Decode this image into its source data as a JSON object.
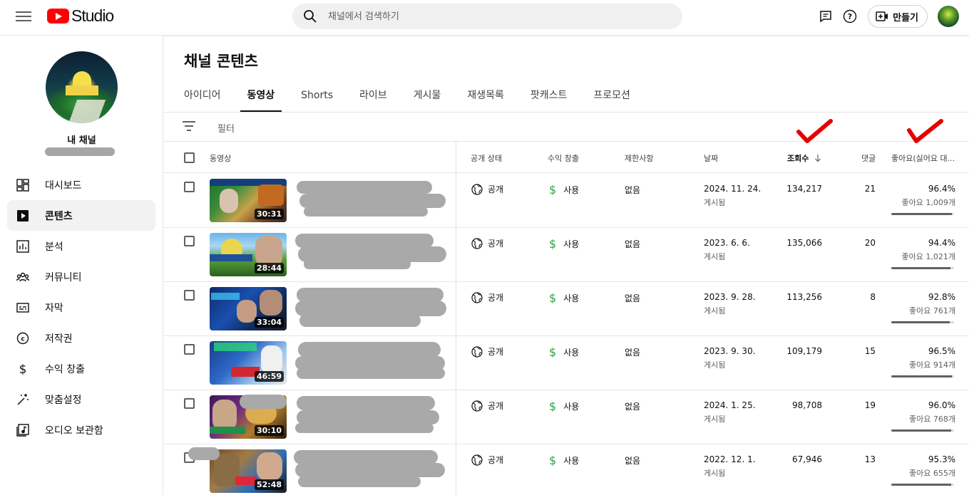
{
  "app": {
    "name": "Studio"
  },
  "search": {
    "placeholder": "채널에서 검색하기"
  },
  "header": {
    "create_label": "만들기"
  },
  "sidebar": {
    "channel_label": "내 채널",
    "items": [
      {
        "label": "대시보드",
        "icon": "dashboard-icon",
        "active": false
      },
      {
        "label": "콘텐츠",
        "icon": "content-icon",
        "active": true
      },
      {
        "label": "분석",
        "icon": "analytics-icon",
        "active": false
      },
      {
        "label": "커뮤니티",
        "icon": "community-icon",
        "active": false
      },
      {
        "label": "자막",
        "icon": "subtitles-icon",
        "active": false
      },
      {
        "label": "저작권",
        "icon": "copyright-icon",
        "active": false
      },
      {
        "label": "수익 창출",
        "icon": "dollar-icon",
        "active": false
      },
      {
        "label": "맞춤설정",
        "icon": "magic-wand-icon",
        "active": false
      },
      {
        "label": "오디오 보관함",
        "icon": "audio-library-icon",
        "active": false
      }
    ]
  },
  "main": {
    "title": "채널 콘텐츠",
    "tabs": [
      "아이디어",
      "동영상",
      "Shorts",
      "라이브",
      "게시물",
      "재생목록",
      "팟캐스트",
      "프로모션"
    ],
    "active_tab": "동영상",
    "filter_label": "필터"
  },
  "table": {
    "columns": {
      "video": "동영상",
      "visibility": "공개 상태",
      "monetization": "수익 창출",
      "restrictions": "제한사항",
      "date": "날짜",
      "views": "조회수",
      "comments": "댓글",
      "likes": "좋아요(싫어요 대..."
    },
    "sorted_by": "views",
    "rows": [
      {
        "duration": "30:31",
        "visibility": "공개",
        "monetization": "사용",
        "restrictions": "없음",
        "date": "2024. 11. 24.",
        "date_status": "게시됨",
        "views": "134,217",
        "comments": "21",
        "like_pct": "96.4%",
        "like_count": "좋아요 1,009개",
        "like_ratio": 0.964
      },
      {
        "duration": "28:44",
        "visibility": "공개",
        "monetization": "사용",
        "restrictions": "없음",
        "date": "2023. 6. 6.",
        "date_status": "게시됨",
        "views": "135,066",
        "comments": "20",
        "like_pct": "94.4%",
        "like_count": "좋아요 1,021개",
        "like_ratio": 0.944
      },
      {
        "duration": "33:04",
        "visibility": "공개",
        "monetization": "사용",
        "restrictions": "없음",
        "date": "2023. 9. 28.",
        "date_status": "게시됨",
        "views": "113,256",
        "comments": "8",
        "like_pct": "92.8%",
        "like_count": "좋아요 761개",
        "like_ratio": 0.928
      },
      {
        "duration": "46:59",
        "visibility": "공개",
        "monetization": "사용",
        "restrictions": "없음",
        "date": "2023. 9. 30.",
        "date_status": "게시됨",
        "views": "109,179",
        "comments": "15",
        "like_pct": "96.5%",
        "like_count": "좋아요 914개",
        "like_ratio": 0.965
      },
      {
        "duration": "30:10",
        "visibility": "공개",
        "monetization": "사용",
        "restrictions": "없음",
        "date": "2024. 1. 25.",
        "date_status": "게시됨",
        "views": "98,708",
        "comments": "19",
        "like_pct": "96.0%",
        "like_count": "좋아요 768개",
        "like_ratio": 0.96
      },
      {
        "duration": "52:48",
        "visibility": "공개",
        "monetization": "사용",
        "restrictions": "없음",
        "date": "2022. 12. 1.",
        "date_status": "게시됨",
        "views": "67,946",
        "comments": "13",
        "like_pct": "95.3%",
        "like_count": "좋아요 655개",
        "like_ratio": 0.953
      }
    ]
  },
  "colors": {
    "brand_red": "#ff0000",
    "annotation_red": "#e60000",
    "monetization_green": "#2ba640"
  }
}
